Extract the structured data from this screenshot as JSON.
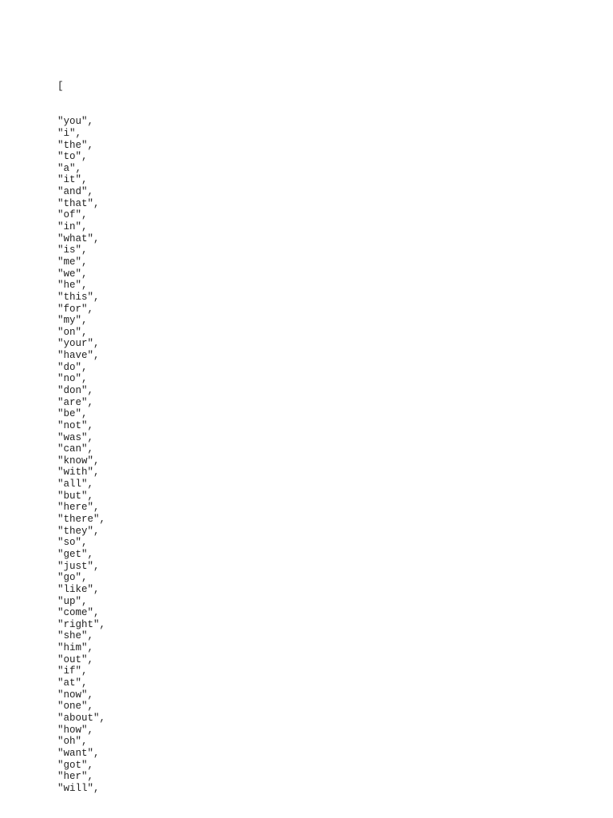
{
  "document": {
    "open_bracket": "[",
    "items": [
      "you",
      "i",
      "the",
      "to",
      "a",
      "it",
      "and",
      "that",
      "of",
      "in",
      "what",
      "is",
      "me",
      "we",
      "he",
      "this",
      "for",
      "my",
      "on",
      "your",
      "have",
      "do",
      "no",
      "don",
      "are",
      "be",
      "not",
      "was",
      "can",
      "know",
      "with",
      "all",
      "but",
      "here",
      "there",
      "they",
      "so",
      "get",
      "just",
      "go",
      "like",
      "up",
      "come",
      "right",
      "she",
      "him",
      "out",
      "if",
      "at",
      "now",
      "one",
      "about",
      "how",
      "oh",
      "want",
      "got",
      "her",
      "will"
    ]
  }
}
